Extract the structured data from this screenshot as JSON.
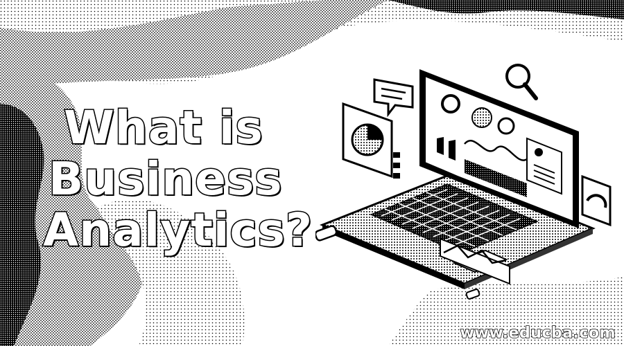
{
  "title": {
    "line1": "What is",
    "line2": "Business",
    "line3": "Analytics?"
  },
  "watermark": "www.educba.com",
  "illustration": {
    "subject": "laptop-with-analytics-dashboard"
  },
  "colors": {
    "background": "#ffffff",
    "ink": "#000000",
    "text_fill": "#ffffff"
  }
}
